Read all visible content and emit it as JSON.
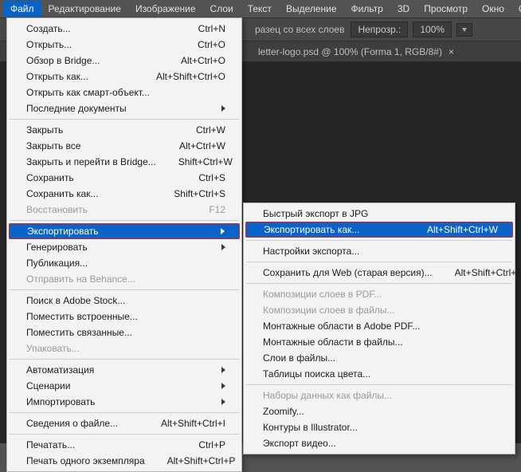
{
  "menubar": [
    "Файл",
    "Редактирование",
    "Изображение",
    "Слои",
    "Текст",
    "Выделение",
    "Фильтр",
    "3D",
    "Просмотр",
    "Окно",
    "Справка"
  ],
  "menubar_active_index": 0,
  "optbar": {
    "sample_label": "разец со всех слоев",
    "btn1": "Непрозр.:",
    "zoom": "100%"
  },
  "doctab": {
    "title": "letter-logo.psd @ 100% (Forma 1, RGB/8#)",
    "close": "×"
  },
  "file_menu": [
    {
      "label": "Создать...",
      "shortcut": "Ctrl+N",
      "sub": false,
      "disabled": false
    },
    {
      "label": "Открыть...",
      "shortcut": "Ctrl+O",
      "sub": false,
      "disabled": false
    },
    {
      "label": "Обзор в Bridge...",
      "shortcut": "Alt+Ctrl+O",
      "sub": false,
      "disabled": false
    },
    {
      "label": "Открыть как...",
      "shortcut": "Alt+Shift+Ctrl+O",
      "sub": false,
      "disabled": false
    },
    {
      "label": "Открыть как смарт-объект...",
      "shortcut": "",
      "sub": false,
      "disabled": false
    },
    {
      "label": "Последние документы",
      "shortcut": "",
      "sub": true,
      "disabled": false
    },
    {
      "sep": true
    },
    {
      "label": "Закрыть",
      "shortcut": "Ctrl+W",
      "sub": false,
      "disabled": false
    },
    {
      "label": "Закрыть все",
      "shortcut": "Alt+Ctrl+W",
      "sub": false,
      "disabled": false
    },
    {
      "label": "Закрыть и перейти в Bridge...",
      "shortcut": "Shift+Ctrl+W",
      "sub": false,
      "disabled": false
    },
    {
      "label": "Сохранить",
      "shortcut": "Ctrl+S",
      "sub": false,
      "disabled": false
    },
    {
      "label": "Сохранить как...",
      "shortcut": "Shift+Ctrl+S",
      "sub": false,
      "disabled": false
    },
    {
      "label": "Восстановить",
      "shortcut": "F12",
      "sub": false,
      "disabled": true
    },
    {
      "sep": true
    },
    {
      "label": "Экспортировать",
      "shortcut": "",
      "sub": true,
      "disabled": false,
      "selected": true,
      "red": true
    },
    {
      "label": "Генерировать",
      "shortcut": "",
      "sub": true,
      "disabled": false
    },
    {
      "label": "Публикация...",
      "shortcut": "",
      "sub": false,
      "disabled": false
    },
    {
      "label": "Отправить на Behance...",
      "shortcut": "",
      "sub": false,
      "disabled": true
    },
    {
      "sep": true
    },
    {
      "label": "Поиск в Adobe Stock...",
      "shortcut": "",
      "sub": false,
      "disabled": false
    },
    {
      "label": "Поместить встроенные...",
      "shortcut": "",
      "sub": false,
      "disabled": false
    },
    {
      "label": "Поместить связанные...",
      "shortcut": "",
      "sub": false,
      "disabled": false
    },
    {
      "label": "Упаковать...",
      "shortcut": "",
      "sub": false,
      "disabled": true
    },
    {
      "sep": true
    },
    {
      "label": "Автоматизация",
      "shortcut": "",
      "sub": true,
      "disabled": false
    },
    {
      "label": "Сценарии",
      "shortcut": "",
      "sub": true,
      "disabled": false
    },
    {
      "label": "Импортировать",
      "shortcut": "",
      "sub": true,
      "disabled": false
    },
    {
      "sep": true
    },
    {
      "label": "Сведения о файле...",
      "shortcut": "Alt+Shift+Ctrl+I",
      "sub": false,
      "disabled": false
    },
    {
      "sep": true
    },
    {
      "label": "Печатать...",
      "shortcut": "Ctrl+P",
      "sub": false,
      "disabled": false
    },
    {
      "label": "Печать одного экземпляра",
      "shortcut": "Alt+Shift+Ctrl+P",
      "sub": false,
      "disabled": false
    }
  ],
  "export_menu": [
    {
      "label": "Быстрый экспорт в JPG",
      "shortcut": "",
      "disabled": false
    },
    {
      "label": "Экспортировать как...",
      "shortcut": "Alt+Shift+Ctrl+W",
      "disabled": false,
      "selected": true,
      "red": true
    },
    {
      "sep": true
    },
    {
      "label": "Настройки экспорта...",
      "shortcut": "",
      "disabled": false
    },
    {
      "sep": true
    },
    {
      "label": "Сохранить для Web (старая версия)...",
      "shortcut": "Alt+Shift+Ctrl+S",
      "disabled": false
    },
    {
      "sep": true
    },
    {
      "label": "Композиции слоев в PDF...",
      "shortcut": "",
      "disabled": true
    },
    {
      "label": "Композиции слоев в файлы...",
      "shortcut": "",
      "disabled": true
    },
    {
      "label": "Монтажные области в Adobe PDF...",
      "shortcut": "",
      "disabled": false
    },
    {
      "label": "Монтажные области в файлы...",
      "shortcut": "",
      "disabled": false
    },
    {
      "label": "Слои в файлы...",
      "shortcut": "",
      "disabled": false
    },
    {
      "label": "Таблицы поиска цвета...",
      "shortcut": "",
      "disabled": false
    },
    {
      "sep": true
    },
    {
      "label": "Наборы данных как файлы...",
      "shortcut": "",
      "disabled": true
    },
    {
      "label": "Zoomify...",
      "shortcut": "",
      "disabled": false
    },
    {
      "label": "Контуры в Illustrator...",
      "shortcut": "",
      "disabled": false
    },
    {
      "label": "Экспорт видео...",
      "shortcut": "",
      "disabled": false
    }
  ]
}
